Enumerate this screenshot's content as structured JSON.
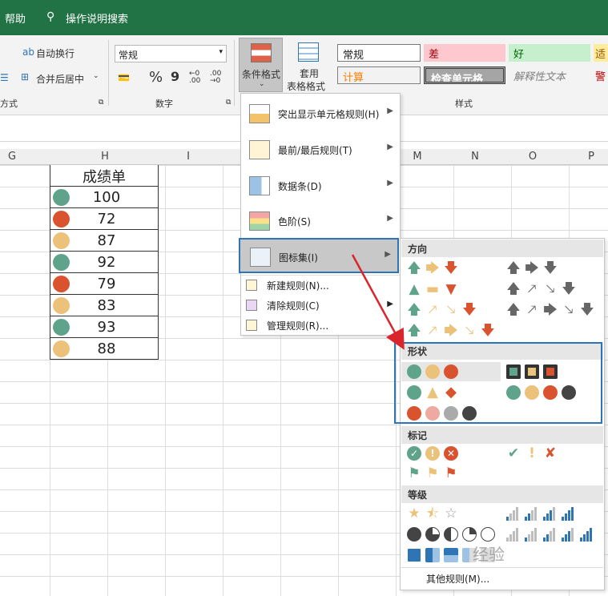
{
  "titlebar": {
    "help": "帮助",
    "tell_me": "操作说明搜索"
  },
  "ribbon": {
    "wrap_text": "自动换行",
    "merge_center": "合并后居中",
    "align_group": "方式",
    "number_group": "数字",
    "style_group": "样式",
    "number_format": "常规",
    "percent": "%",
    "comma": "9",
    "inc_dec": "←0 .00",
    "dec_dec": ".00 →0",
    "cond_format": "条件格式",
    "table_format_1": "套用",
    "table_format_2": "表格格式",
    "styles": {
      "normal": "常规",
      "bad": "差",
      "good": "好",
      "neutral": "适",
      "calc": "计算",
      "check": "检查单元格",
      "explain": "解释性文本",
      "warn": "警"
    }
  },
  "columns": [
    "G",
    "H",
    "I",
    "M",
    "N",
    "O",
    "P"
  ],
  "table": {
    "title": "成绩单",
    "rows": [
      {
        "value": "100",
        "color": "#5fa38a"
      },
      {
        "value": "72",
        "color": "#d9532f"
      },
      {
        "value": "87",
        "color": "#ecc27a"
      },
      {
        "value": "92",
        "color": "#5fa38a"
      },
      {
        "value": "79",
        "color": "#d9532f"
      },
      {
        "value": "83",
        "color": "#ecc27a"
      },
      {
        "value": "93",
        "color": "#5fa38a"
      },
      {
        "value": "88",
        "color": "#ecc27a"
      }
    ]
  },
  "cf_menu": {
    "items": [
      "突出显示单元格规则(H)",
      "最前/最后规则(T)",
      "数据条(D)",
      "色阶(S)",
      "图标集(I)"
    ],
    "new_rule": "新建规则(N)...",
    "clear_rule": "清除规则(C)",
    "manage_rule": "管理规则(R)..."
  },
  "icon_sets": {
    "direction": "方向",
    "shapes": "形状",
    "indicators": "标记",
    "ratings": "等级",
    "more_rules": "其他规则(M)..."
  },
  "colors": {
    "green": "#5fa38a",
    "yellow": "#ecc27a",
    "red": "#d9532f",
    "excel_green": "#217346",
    "highlight": "#2e75b6",
    "arrow_red": "#d9262c"
  },
  "watermark": "经验"
}
